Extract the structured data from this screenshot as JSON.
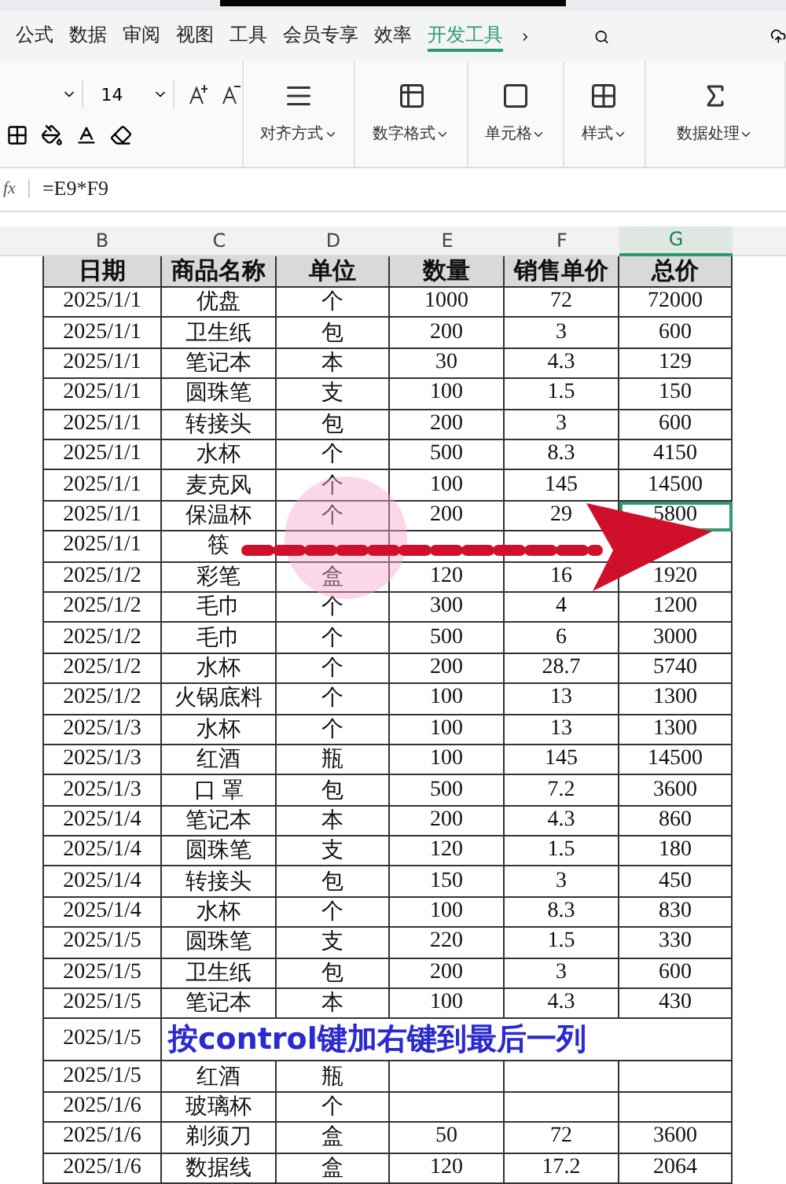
{
  "menu_tabs": [
    {
      "label": "公式",
      "selected": false
    },
    {
      "label": "数据",
      "selected": false
    },
    {
      "label": "审阅",
      "selected": false
    },
    {
      "label": "视图",
      "selected": false
    },
    {
      "label": "工具",
      "selected": false
    },
    {
      "label": "会员专享",
      "selected": false
    },
    {
      "label": "效率",
      "selected": false
    },
    {
      "label": "开发工具",
      "selected": true
    }
  ],
  "ribbon": {
    "font_size": "14",
    "groups": [
      {
        "label": "对齐方式",
        "kind": "align"
      },
      {
        "label": "数字格式",
        "kind": "number"
      },
      {
        "label": "单元格",
        "kind": "cell"
      },
      {
        "label": "样式",
        "kind": "style"
      },
      {
        "label": "数据处理",
        "kind": "sum"
      }
    ]
  },
  "formula_bar": {
    "fx": "fx",
    "formula": "=E9*F9"
  },
  "sheet": {
    "columns": [
      {
        "label": "B",
        "selected": false
      },
      {
        "label": "C",
        "selected": false
      },
      {
        "label": "D",
        "selected": false
      },
      {
        "label": "E",
        "selected": false
      },
      {
        "label": "F",
        "selected": false
      },
      {
        "label": "G",
        "selected": true
      }
    ],
    "header": [
      "日期",
      "商品名称",
      "单位",
      "数量",
      "销售单价",
      "总价"
    ],
    "rows": [
      {
        "selected": false,
        "cells": [
          "2025/1/1",
          "优盘",
          "个",
          "1000",
          "72",
          "72000"
        ]
      },
      {
        "selected": false,
        "cells": [
          "2025/1/1",
          "卫生纸",
          "包",
          "200",
          "3",
          "600"
        ]
      },
      {
        "selected": false,
        "cells": [
          "2025/1/1",
          "笔记本",
          "本",
          "30",
          "4.3",
          "129"
        ]
      },
      {
        "selected": false,
        "cells": [
          "2025/1/1",
          "圆珠笔",
          "支",
          "100",
          "1.5",
          "150"
        ]
      },
      {
        "selected": false,
        "cells": [
          "2025/1/1",
          "转接头",
          "包",
          "200",
          "3",
          "600"
        ]
      },
      {
        "selected": false,
        "cells": [
          "2025/1/1",
          "水杯",
          "个",
          "500",
          "8.3",
          "4150"
        ]
      },
      {
        "selected": false,
        "cells": [
          "2025/1/1",
          "麦克风",
          "个",
          "100",
          "145",
          "14500"
        ]
      },
      {
        "selected": true,
        "cells": [
          "2025/1/1",
          "保温杯",
          "个",
          "200",
          "29",
          "5800"
        ]
      },
      {
        "selected": false,
        "cells": [
          "2025/1/1",
          "筷",
          null,
          null,
          null,
          null
        ]
      },
      {
        "selected": false,
        "cells": [
          "2025/1/2",
          "彩笔",
          "盒",
          "120",
          "16",
          "1920"
        ]
      },
      {
        "selected": false,
        "cells": [
          "2025/1/2",
          "毛巾",
          "个",
          "300",
          "4",
          "1200"
        ]
      },
      {
        "selected": false,
        "cells": [
          "2025/1/2",
          "毛巾",
          "个",
          "500",
          "6",
          "3000"
        ]
      },
      {
        "selected": false,
        "cells": [
          "2025/1/2",
          "水杯",
          "个",
          "200",
          "28.7",
          "5740"
        ]
      },
      {
        "selected": false,
        "cells": [
          "2025/1/2",
          "火锅底料",
          "个",
          "100",
          "13",
          "1300"
        ]
      },
      {
        "selected": false,
        "cells": [
          "2025/1/3",
          "水杯",
          "个",
          "100",
          "13",
          "1300"
        ]
      },
      {
        "selected": false,
        "cells": [
          "2025/1/3",
          "红酒",
          "瓶",
          "100",
          "145",
          "14500"
        ]
      },
      {
        "selected": false,
        "cells": [
          "2025/1/3",
          "口 罩",
          "包",
          "500",
          "7.2",
          "3600"
        ]
      },
      {
        "selected": false,
        "cells": [
          "2025/1/4",
          "笔记本",
          "本",
          "200",
          "4.3",
          "860"
        ]
      },
      {
        "selected": false,
        "cells": [
          "2025/1/4",
          "圆珠笔",
          "支",
          "120",
          "1.5",
          "180"
        ]
      },
      {
        "selected": false,
        "cells": [
          "2025/1/4",
          "转接头",
          "包",
          "150",
          "3",
          "450"
        ]
      },
      {
        "selected": false,
        "cells": [
          "2025/1/4",
          "水杯",
          "个",
          "100",
          "8.3",
          "830"
        ]
      },
      {
        "selected": false,
        "cells": [
          "2025/1/5",
          "圆珠笔",
          "支",
          "220",
          "1.5",
          "330"
        ]
      },
      {
        "selected": false,
        "cells": [
          "2025/1/5",
          "卫生纸",
          "包",
          "200",
          "3",
          "600"
        ]
      },
      {
        "selected": false,
        "cells": [
          "2025/1/5",
          "笔记本",
          "本",
          "100",
          "4.3",
          "430"
        ]
      },
      {
        "selected": false,
        "cells": [
          "2025/1/5",
          null,
          null,
          null,
          null,
          null
        ]
      },
      {
        "selected": false,
        "cells": [
          "2025/1/5",
          "红酒",
          "瓶",
          null,
          null,
          null
        ]
      },
      {
        "selected": false,
        "cells": [
          "2025/1/6",
          "玻璃杯",
          "个",
          null,
          null,
          null
        ]
      },
      {
        "selected": false,
        "cells": [
          "2025/1/6",
          "剃须刀",
          "盒",
          "50",
          "72",
          "3600"
        ]
      },
      {
        "selected": false,
        "cells": [
          "2025/1/6",
          "数据线",
          "盒",
          "120",
          "17.2",
          "2064"
        ]
      }
    ]
  },
  "caption": "按control键加右键到最后一列"
}
